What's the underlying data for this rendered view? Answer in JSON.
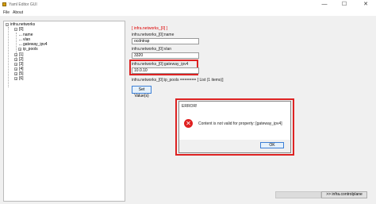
{
  "window": {
    "title": "Yaml Editor GUI",
    "minimize": "—",
    "maximize": "☐",
    "close": "✕"
  },
  "menu": {
    "file": "File",
    "about": "About"
  },
  "tree": {
    "root": "infra.networks",
    "item0": "[0]",
    "name": "name",
    "vlan": "vlan",
    "gateway": "gateway_ipv4",
    "ip_pools": "ip_pools",
    "items": [
      "[1]",
      "[2]",
      "[3]",
      "[4]",
      "[5]",
      "[6]"
    ],
    "expander_minus": "−",
    "expander_plus": "+"
  },
  "editor": {
    "header": "[ infra.networks_[0] ]",
    "name_label": "infra.networks_[0]:name",
    "name_value": "ocdntrap",
    "vlan_label": "infra.networks_[0]:vlan",
    "vlan_value": "3320",
    "gateway_label": "infra.networks_[0]:gateway_ipv4",
    "gateway_value": "10.0.10",
    "ip_pools_label": "infra.networks_[0]:ip_pools ======= [ List (1 items)]",
    "set_values": "Set Value(s)"
  },
  "dialog": {
    "title": "ERROR!",
    "message": "Content is not valid for property: [gateway_ipv4]",
    "ok": "OK",
    "icon": "error-icon",
    "icon_glyph": "✕"
  },
  "nav": {
    "prev": "",
    "next": ">> infra.controlplane"
  },
  "colors": {
    "highlight": "#d22222",
    "accent": "#3c7fd6",
    "error": "#e02020"
  }
}
